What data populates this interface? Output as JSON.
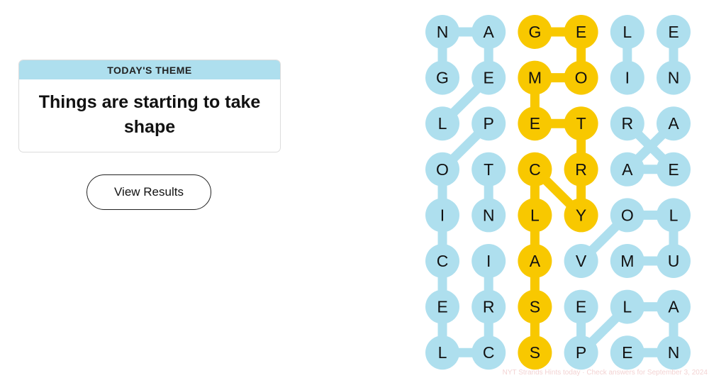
{
  "theme": {
    "header": "TODAY'S THEME",
    "text": "Things are starting to take shape"
  },
  "results_button": {
    "label": "View Results"
  },
  "colors": {
    "theme_word": "#aedfee",
    "spangram": "#f8c800",
    "letter": "#111111"
  },
  "grid": {
    "rows": [
      [
        "N",
        "A",
        "G",
        "E",
        "L",
        "E"
      ],
      [
        "G",
        "E",
        "M",
        "O",
        "I",
        "N"
      ],
      [
        "L",
        "P",
        "E",
        "T",
        "R",
        "A"
      ],
      [
        "O",
        "T",
        "C",
        "R",
        "A",
        "E"
      ],
      [
        "I",
        "N",
        "L",
        "Y",
        "O",
        "L"
      ],
      [
        "C",
        "I",
        "A",
        "V",
        "M",
        "U"
      ],
      [
        "E",
        "R",
        "S",
        "E",
        "L",
        "A"
      ],
      [
        "L",
        "C",
        "S",
        "P",
        "E",
        "N"
      ]
    ],
    "cell_types": [
      [
        "word",
        "word",
        "spangram",
        "spangram",
        "word",
        "word"
      ],
      [
        "word",
        "word",
        "spangram",
        "spangram",
        "word",
        "word"
      ],
      [
        "word",
        "word",
        "spangram",
        "spangram",
        "word",
        "word"
      ],
      [
        "word",
        "word",
        "spangram",
        "spangram",
        "word",
        "word"
      ],
      [
        "word",
        "word",
        "spangram",
        "spangram",
        "word",
        "word"
      ],
      [
        "word",
        "word",
        "spangram",
        "word",
        "word",
        "word"
      ],
      [
        "word",
        "word",
        "spangram",
        "word",
        "word",
        "word"
      ],
      [
        "word",
        "word",
        "spangram",
        "word",
        "word",
        "word"
      ]
    ],
    "paths": [
      {
        "type": "word",
        "cells": [
          [
            1,
            0
          ],
          [
            0,
            0
          ],
          [
            0,
            1
          ],
          [
            1,
            1
          ],
          [
            2,
            0
          ]
        ]
      },
      {
        "type": "word",
        "cells": [
          [
            2,
            1
          ],
          [
            3,
            0
          ],
          [
            4,
            0
          ],
          [
            5,
            0
          ],
          [
            6,
            0
          ],
          [
            7,
            0
          ],
          [
            7,
            1
          ],
          [
            6,
            1
          ],
          [
            5,
            1
          ]
        ]
      },
      {
        "type": "word",
        "cells": [
          [
            3,
            1
          ],
          [
            4,
            1
          ]
        ]
      },
      {
        "type": "spangram",
        "cells": [
          [
            0,
            2
          ],
          [
            0,
            3
          ],
          [
            1,
            3
          ],
          [
            1,
            2
          ],
          [
            2,
            2
          ],
          [
            2,
            3
          ],
          [
            3,
            3
          ],
          [
            4,
            3
          ],
          [
            3,
            2
          ],
          [
            4,
            2
          ],
          [
            5,
            2
          ],
          [
            6,
            2
          ],
          [
            7,
            2
          ]
        ]
      },
      {
        "type": "word",
        "cells": [
          [
            0,
            4
          ],
          [
            1,
            4
          ]
        ]
      },
      {
        "type": "word",
        "cells": [
          [
            0,
            5
          ],
          [
            1,
            5
          ]
        ]
      },
      {
        "type": "word",
        "cells": [
          [
            2,
            4
          ],
          [
            3,
            5
          ],
          [
            3,
            4
          ],
          [
            2,
            5
          ]
        ]
      },
      {
        "type": "word",
        "cells": [
          [
            5,
            3
          ],
          [
            4,
            4
          ],
          [
            4,
            5
          ],
          [
            5,
            5
          ],
          [
            5,
            4
          ]
        ]
      },
      {
        "type": "word",
        "cells": [
          [
            6,
            3
          ],
          [
            7,
            3
          ],
          [
            6,
            4
          ],
          [
            6,
            5
          ],
          [
            7,
            5
          ],
          [
            7,
            4
          ]
        ]
      }
    ]
  }
}
